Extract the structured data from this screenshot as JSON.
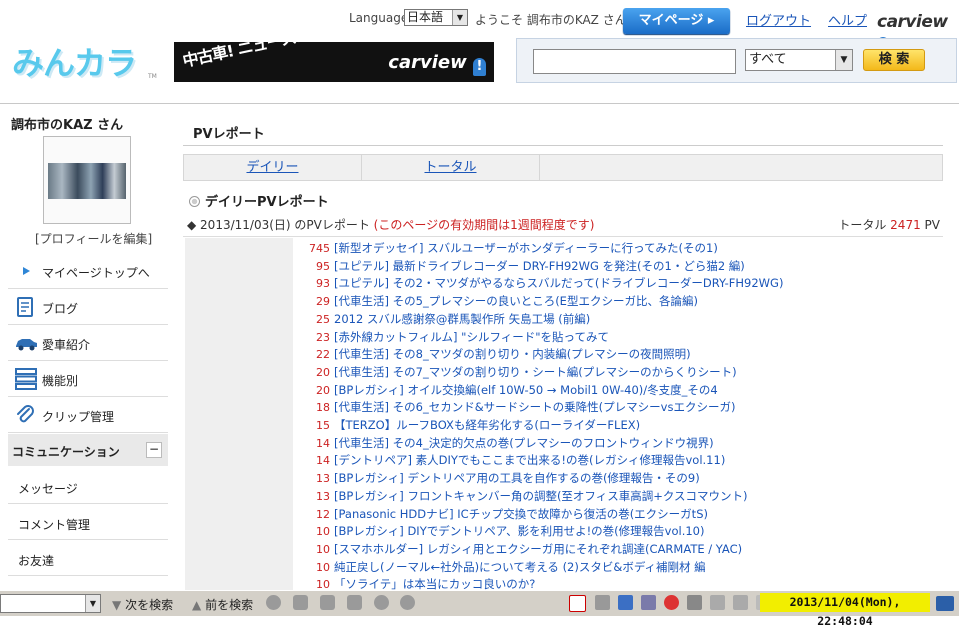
{
  "header": {
    "language_label": "Language",
    "language_value": "日本語",
    "welcome": "ようこそ 調布市のKAZ さん",
    "mypage_label": "マイページ ▸",
    "logout_label": "ログアウト",
    "help_label": "ヘルプ",
    "carview_logo": "carview",
    "site_logo": "みんカラ",
    "site_logo_tm": "TM",
    "banner_text": "中古車! ニュース! 編集記事! バイク!",
    "banner_logo": "carview"
  },
  "search": {
    "placeholder": "",
    "scope_value": "すべて",
    "button_label": "検 索"
  },
  "sidebar": {
    "user_name": "調布市のKAZ さん",
    "profile_edit": "[プロフィールを編集]",
    "items": [
      {
        "label": "マイページトップへ",
        "icon": "play-arrow-icon"
      },
      {
        "label": "ブログ",
        "icon": "blog-notepad-icon"
      },
      {
        "label": "愛車紹介",
        "icon": "car-icon"
      },
      {
        "label": "機能別",
        "icon": "list-icon"
      },
      {
        "label": "クリップ管理",
        "icon": "paperclip-icon"
      }
    ],
    "community_label": "コミュニケーション",
    "community_toggle": "−",
    "community_items": [
      "メッセージ",
      "コメント管理",
      "お友達"
    ]
  },
  "main": {
    "title": "PVレポート",
    "tabs": [
      "デイリー",
      "トータル"
    ],
    "section_title": "デイリーPVレポート",
    "date_prefix": "◆ 2013/11/03(日) のPVレポート",
    "date_note": "(このページの有効期間は1週間程度です)",
    "total_label": "トータル",
    "total_value": "2471",
    "total_unit": "PV",
    "rows": [
      {
        "count": "745",
        "title": "[新型オデッセイ] スバルユーザーがホンダディーラーに行ってみた(その1)"
      },
      {
        "count": "95",
        "title": "[ユピテル] 最新ドライブレコーダー DRY-FH92WG を発注(その1・どら猫2 編)"
      },
      {
        "count": "93",
        "title": "[ユピテル] その2・マツダがやるならスバルだって(ドライブレコーダーDRY-FH92WG)"
      },
      {
        "count": "29",
        "title": "[代車生活] その5_プレマシーの良いところ(E型エクシーガ比、各論編)"
      },
      {
        "count": "25",
        "title": "2012 スバル感謝祭@群馬製作所 矢島工場 (前編)"
      },
      {
        "count": "23",
        "title": "[赤外線カットフィルム] \"シルフィード\"を貼ってみて"
      },
      {
        "count": "22",
        "title": "[代車生活] その8_マツダの割り切り・内装編(プレマシーの夜間照明)"
      },
      {
        "count": "20",
        "title": "[代車生活] その7_マツダの割り切り・シート編(プレマシーのからくりシート)"
      },
      {
        "count": "20",
        "title": "[BPレガシィ] オイル交換編(elf 10W-50 → Mobil1 0W-40)/冬支度_その4"
      },
      {
        "count": "18",
        "title": "[代車生活] その6_セカンド&サードシートの乗降性(プレマシーvsエクシーガ)"
      },
      {
        "count": "15",
        "title": "【TERZO】ルーフBOXも経年劣化する(ローライダーFLEX)"
      },
      {
        "count": "14",
        "title": "[代車生活] その4_決定的欠点の巻(プレマシーのフロントウィンドウ視界)"
      },
      {
        "count": "14",
        "title": "[デントリペア] 素人DIYでもここまで出来る!の巻(レガシィ修理報告vol.11)"
      },
      {
        "count": "13",
        "title": "[BPレガシィ] デントリペア用の工具を自作するの巻(修理報告・その9)"
      },
      {
        "count": "13",
        "title": "[BPレガシィ] フロントキャンバー角の調整(至オフィス車高調+クスコマウント)"
      },
      {
        "count": "12",
        "title": "[Panasonic HDDナビ] ICチップ交換で故障から復活の巻(エクシーガtS)"
      },
      {
        "count": "10",
        "title": "[BPレガシィ] DIYでデントリペア、影を利用せよ!の巻(修理報告vol.10)"
      },
      {
        "count": "10",
        "title": "[スマホホルダー] レガシィ用とエクシーガ用にそれぞれ調達(CARMATE / YAC)"
      },
      {
        "count": "10",
        "title": "純正戻し(ノーマル←社外品)について考える (2)スタビ&ボディ補剛材 編"
      },
      {
        "count": "10",
        "title": "「ソライテ」は本当にカッコ良いのか?"
      }
    ]
  },
  "taskbar": {
    "next_label": "次を検索",
    "prev_label": "前を検索",
    "clock": "2013/11/04(Mon), 22:48:04"
  },
  "colors": {
    "accent_blue": "#1a55b8",
    "count_red": "#cc2222",
    "logo_cyan": "#58c9ec",
    "clock_yellow": "#f2ee00"
  }
}
